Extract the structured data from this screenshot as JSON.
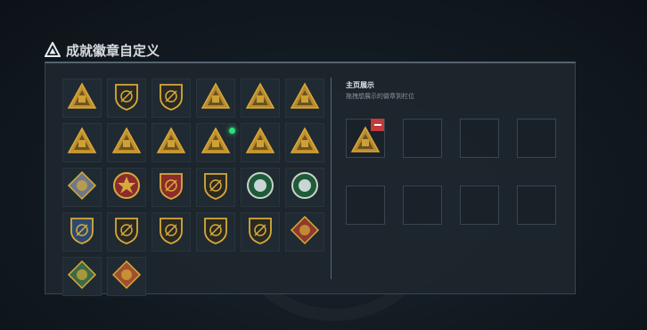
{
  "page": {
    "title": "成就徽章自定义"
  },
  "showcase": {
    "title": "主页展示",
    "hint": "拖拽想展示的徽章到栏位",
    "slots": [
      {
        "filled": true,
        "badge": "pixel-pyramid-badge"
      },
      {
        "filled": false
      },
      {
        "filled": false
      },
      {
        "filled": false
      },
      {
        "filled": false
      },
      {
        "filled": false
      },
      {
        "filled": false
      },
      {
        "filled": false
      }
    ]
  },
  "badges": [
    "triangle-emblem",
    "helicopter-emblem",
    "shield-wings-emblem",
    "pixel-pyramid-gold",
    "pixel-triangle-flag",
    "pixel-triangle-crown",
    "triangle-tank",
    "triangle-runner",
    "triangle-number-one",
    "triangle-pixel-box",
    "triangle-rider",
    "triangle-truck",
    "diamond-silver",
    "medal-wreath-red",
    "shield-ribbon-red",
    "shield-gold-skull",
    "round-green-bird",
    "round-green-skull",
    "shield-blue-eagle",
    "shield-rifle",
    "shield-rifle-2",
    "shield-no-symbol",
    "shield-eagle-ribbon",
    "diamond-red-beast",
    "diamond-green-wings",
    "diamond-orange-claw"
  ],
  "colors": {
    "accent_gold": "#d8a93a",
    "new_dot": "#2ee07c",
    "remove_red": "#c23a3a"
  }
}
